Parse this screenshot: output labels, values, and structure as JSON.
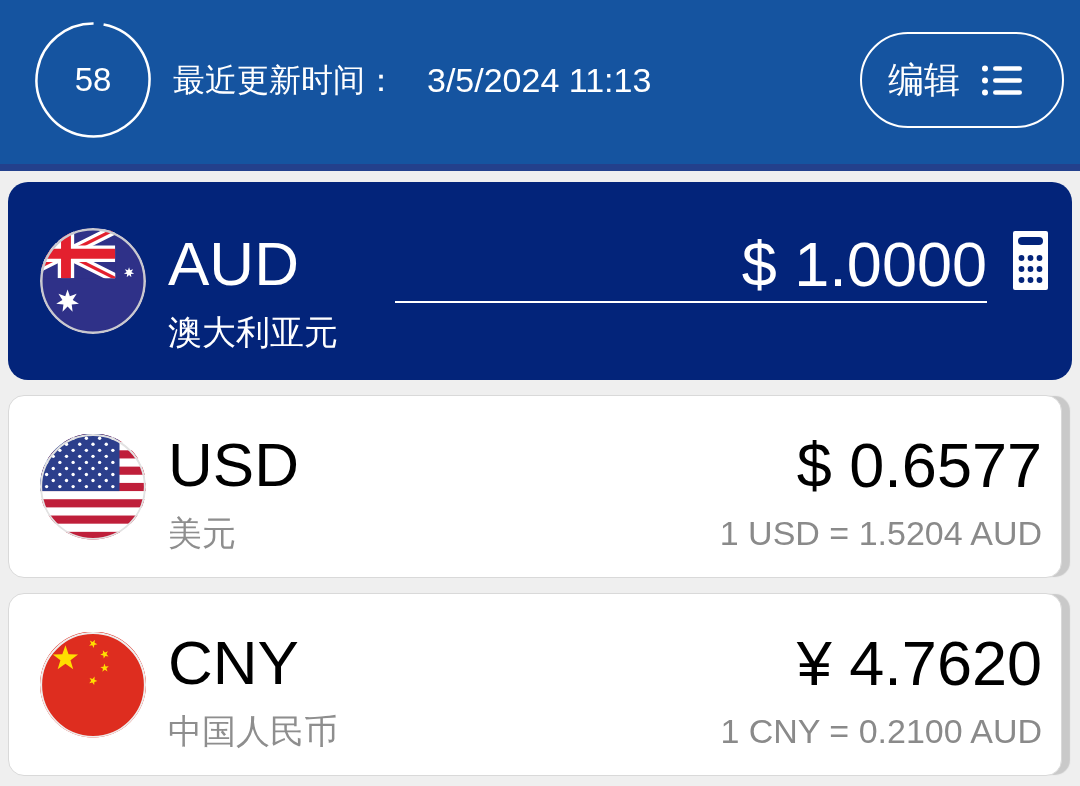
{
  "header": {
    "countdown": {
      "value": "58",
      "level": 0.97
    },
    "updated_label": "最近更新时间：",
    "updated_time": "3/5/2024 11:13",
    "edit_button": {
      "label": "编辑"
    }
  },
  "currencies": [
    {
      "kind": "australia",
      "code": "AUD",
      "name": "澳大利亚元",
      "amount": "$ 1.0000",
      "selected": true
    },
    {
      "kind": "usa",
      "code": "USD",
      "name": "美元",
      "amount": "$ 0.6577",
      "rate": "1 USD = 1.5204 AUD",
      "selected": false
    },
    {
      "kind": "china",
      "code": "CNY",
      "name": "中国人民币",
      "amount": "¥ 4.7620",
      "rate": "1 CNY = 0.2100 AUD",
      "selected": false
    }
  ]
}
